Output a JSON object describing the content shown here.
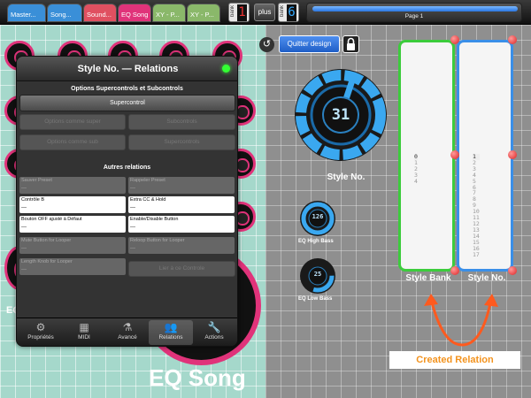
{
  "top_bar": {
    "tabs": [
      {
        "label": "Master...",
        "color": "#3a8fd8"
      },
      {
        "label": "Song...",
        "color": "#3a8fd8"
      },
      {
        "label": "Sound...",
        "color": "#e05060"
      },
      {
        "label": "EQ Song",
        "color": "#e0337a"
      },
      {
        "label": "XY - P...",
        "color": "#8ab86a"
      },
      {
        "label": "XY - P...",
        "color": "#8ab86a"
      }
    ],
    "bank1": {
      "label": "bank",
      "value": "1"
    },
    "plus": "plus",
    "bank2": {
      "label": "bank",
      "value": "6"
    },
    "page_label": "Page 1"
  },
  "design": {
    "quit_label": "Quitter design",
    "undo_icon": "undo-icon",
    "lock_icon": "lock-icon"
  },
  "panel": {
    "title": "Style No. — Relations",
    "status_color": "#33ff33",
    "section1": "Options Supercontrols et Subcontrols",
    "supercontrol_btn": "Supercontrol",
    "opt_super": "Options comme super",
    "subcontrols": "Subcontrols",
    "opt_sub": "Options comme sub",
    "supercontrols": "Supercontrols",
    "section2": "Autres relations",
    "fields": [
      {
        "label": "Sauver Preset",
        "value": "---",
        "enabled": false
      },
      {
        "label": "Rappeler Preset",
        "value": "---",
        "enabled": false
      },
      {
        "label": "Contrôle B",
        "value": "---",
        "enabled": true
      },
      {
        "label": "Extra CC & Hold",
        "value": "---",
        "enabled": true
      },
      {
        "label": "Bouton OFF ajusté à Défaut",
        "value": "---",
        "enabled": true
      },
      {
        "label": "Enable/Disable Button",
        "value": "---",
        "enabled": true
      },
      {
        "label": "Mute Button for Looper",
        "value": "---",
        "enabled": false
      },
      {
        "label": "Reloop Button for Looper",
        "value": "---",
        "enabled": false
      },
      {
        "label": "Length Knob for Looper",
        "value": "---",
        "enabled": false
      }
    ],
    "dim_button": "Lier à ce Controle",
    "tabs": [
      {
        "label": "Propriétés",
        "icon": "gears-icon"
      },
      {
        "label": "MIDI",
        "icon": "keyboard-icon"
      },
      {
        "label": "Avancé",
        "icon": "flask-icon"
      },
      {
        "label": "Relations",
        "icon": "people-icon"
      },
      {
        "label": "Actions",
        "icon": "wrench-icon"
      }
    ]
  },
  "controls": {
    "style_knob": {
      "value": "31",
      "label": "Style No.",
      "level": 0.25
    },
    "eq_high": {
      "value": "126",
      "label": "EQ High Bass"
    },
    "eq_low": {
      "value": "25",
      "label": "EQ Low Bass"
    }
  },
  "lists": {
    "style_bank": {
      "label": "Style Bank",
      "items": [
        "0",
        "1",
        "2",
        "3",
        "4"
      ],
      "border": "#3ccc3c"
    },
    "style_no": {
      "label": "Style No.",
      "items": [
        "1",
        "2",
        "3",
        "4",
        "5",
        "6",
        "7",
        "8",
        "9",
        "10",
        "11",
        "12",
        "13",
        "14",
        "15",
        "16",
        "17"
      ],
      "border": "#3a8fe8"
    }
  },
  "background": {
    "eq_song_title": "EQ Song",
    "eq_small": "EQ"
  },
  "annotation": {
    "text": "Created Relation",
    "color": "#f3931e"
  }
}
